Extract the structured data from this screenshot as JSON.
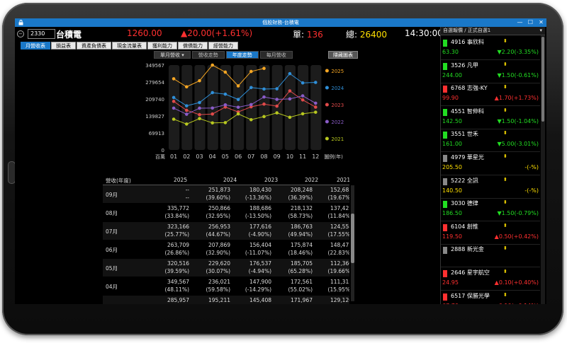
{
  "window": {
    "title": "個股財務-台積電"
  },
  "quote": {
    "code": "2330",
    "name": "台積電",
    "price": "1260.00",
    "change": "▲20.00(+1.61%)",
    "vol_label": "單:",
    "vol_value": "136",
    "total_label": "總:",
    "total_value": "26400",
    "time": "14:30:00"
  },
  "tabs": [
    "月營收表",
    "損益表",
    "資產負債表",
    "現金流量表",
    "獲利能力",
    "償債能力",
    "經營能力"
  ],
  "subtabs": {
    "dropdown": "單月營收",
    "items": [
      "營收走勢",
      "年度走勢",
      "每月營收"
    ],
    "active": 1
  },
  "hide_button": "隱藏圖表",
  "chart_data": {
    "type": "line",
    "x": [
      "01",
      "02",
      "03",
      "04",
      "05",
      "06",
      "07",
      "08",
      "09",
      "10",
      "11",
      "12"
    ],
    "x_prefix": "百萬",
    "x_suffix": "圖例(年)",
    "yticks": [
      "349567",
      "279654",
      "209740",
      "139827",
      "69913",
      "0"
    ],
    "ylim": [
      0,
      349567
    ],
    "series": [
      {
        "name": "2025",
        "color": "#f5a623",
        "values": [
          293000,
          260000,
          285000,
          349567,
          320516,
          263709,
          323166,
          335772,
          null,
          null,
          null,
          null
        ]
      },
      {
        "name": "2024",
        "color": "#2f8fd8",
        "values": [
          215785,
          181648,
          195211,
          236021,
          229620,
          207869,
          256953,
          250866,
          251873,
          314240,
          276058,
          278163
        ]
      },
      {
        "name": "2023",
        "color": "#e04a4a",
        "values": [
          200051,
          163174,
          145408,
          147900,
          176537,
          156404,
          177616,
          188686,
          180430,
          243203,
          206029,
          176300
        ]
      },
      {
        "name": "2022",
        "color": "#8a5cc8",
        "values": [
          172176,
          146933,
          171967,
          172561,
          185705,
          175874,
          186763,
          218132,
          208248,
          210265,
          222706,
          192560
        ]
      },
      {
        "name": "2021",
        "color": "#b8c820",
        "values": [
          126750,
          106530,
          129126,
          111315,
          112360,
          148471,
          124558,
          137427,
          152685,
          134473,
          148877,
          155382
        ]
      }
    ]
  },
  "table": {
    "headers": [
      "營收(年度)",
      "2025",
      "2024",
      "2023",
      "2022",
      "2021"
    ],
    "rows": [
      {
        "month": "09月",
        "values": [
          "--",
          "251,873",
          "180,430",
          "208,248",
          "152,685"
        ],
        "pcts": [
          "--",
          "(39.60%)",
          "(-13.36%)",
          "(36.39%)",
          "(19.67%)"
        ]
      },
      {
        "month": "08月",
        "values": [
          "335,772",
          "250,866",
          "188,686",
          "218,132",
          "137,427"
        ],
        "pcts": [
          "(33.84%)",
          "(32.95%)",
          "(-13.50%)",
          "(58.73%)",
          "(11.84%)"
        ]
      },
      {
        "month": "07月",
        "values": [
          "323,166",
          "256,953",
          "177,616",
          "186,763",
          "124,558"
        ],
        "pcts": [
          "(25.77%)",
          "(44.67%)",
          "(-4.90%)",
          "(49.94%)",
          "(17.55%)"
        ]
      },
      {
        "month": "06月",
        "values": [
          "263,709",
          "207,869",
          "156,404",
          "175,874",
          "148,471"
        ],
        "pcts": [
          "(26.86%)",
          "(32.90%)",
          "(-11.07%)",
          "(18.46%)",
          "(22.83%)"
        ]
      },
      {
        "month": "05月",
        "values": [
          "320,516",
          "229,620",
          "176,537",
          "185,705",
          "112,360"
        ],
        "pcts": [
          "(39.59%)",
          "(30.07%)",
          "(-4.94%)",
          "(65.28%)",
          "(19.66%)"
        ]
      },
      {
        "month": "04月",
        "values": [
          "349,567",
          "236,021",
          "147,900",
          "172,561",
          "111,315"
        ],
        "pcts": [
          "(48.11%)",
          "(59.58%)",
          "(-14.29%)",
          "(55.02%)",
          "(15.95%)"
        ]
      },
      {
        "month": "",
        "values": [
          "285,957",
          "195,211",
          "145,408",
          "171,967",
          "129,126"
        ],
        "pcts": [
          "",
          "",
          "",
          "",
          ""
        ]
      }
    ]
  },
  "watchlist": {
    "header": "自選報價 / 正式自選1",
    "items": [
      {
        "name": "4916 事欣科",
        "price": "63.30",
        "change": "▼2.20(-3.35%)",
        "dir": "down"
      },
      {
        "name": "3526 凡甲",
        "price": "244.00",
        "change": "▼1.50(-0.61%)",
        "dir": "down"
      },
      {
        "name": "6768 志強-KY",
        "price": "99.90",
        "change": "▲1.70(+1.73%)",
        "dir": "up"
      },
      {
        "name": "4551 智伸科",
        "price": "142.50",
        "change": "▼1.50(-1.04%)",
        "dir": "down"
      },
      {
        "name": "3551 世禾",
        "price": "161.00",
        "change": "▼5.00(-3.01%)",
        "dir": "down"
      },
      {
        "name": "4979 華星光",
        "price": "205.50",
        "change": "-(-%)",
        "dir": "flat"
      },
      {
        "name": "5222 全訊",
        "price": "140.50",
        "change": "-(-%)",
        "dir": "flat"
      },
      {
        "name": "3030 德律",
        "price": "186.50",
        "change": "▼1.50(-0.79%)",
        "dir": "down"
      },
      {
        "name": "6104 創惟",
        "price": "119.50",
        "change": "▲0.50(+0.42%)",
        "dir": "up"
      },
      {
        "name": "2888 新光金",
        "price": "",
        "change": "",
        "dir": "flat"
      },
      {
        "name": "2646 星宇航空",
        "price": "24.95",
        "change": "▲0.10(+0.40%)",
        "dir": "up"
      },
      {
        "name": "6517 保勝光學",
        "price": "67.70",
        "change": "▲0.10(+0.14%)",
        "dir": "up"
      }
    ]
  }
}
